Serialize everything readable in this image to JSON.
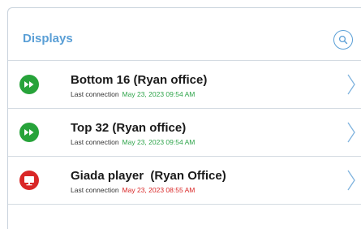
{
  "header": {
    "title": "Displays"
  },
  "devices": [
    {
      "name": "Bottom 16 (Ryan office)",
      "last_connection_label": "Last connection",
      "last_connection_time": "May 23, 2023 09:54 AM",
      "status": "online",
      "status_color": "#27a33a",
      "icon": "play-forward-icon"
    },
    {
      "name": "Top 32 (Ryan office)",
      "last_connection_label": "Last connection",
      "last_connection_time": "May 23, 2023 09:54 AM",
      "status": "online",
      "status_color": "#27a33a",
      "icon": "play-forward-icon"
    },
    {
      "name": "Giada player  (Ryan Office)",
      "last_connection_label": "Last connection",
      "last_connection_time": "May 23, 2023 08:55 AM",
      "status": "offline",
      "status_color": "#d92727",
      "icon": "monitor-icon"
    }
  ],
  "colors": {
    "accent": "#5a9fd6",
    "online": "#27a33a",
    "offline": "#d92727"
  }
}
